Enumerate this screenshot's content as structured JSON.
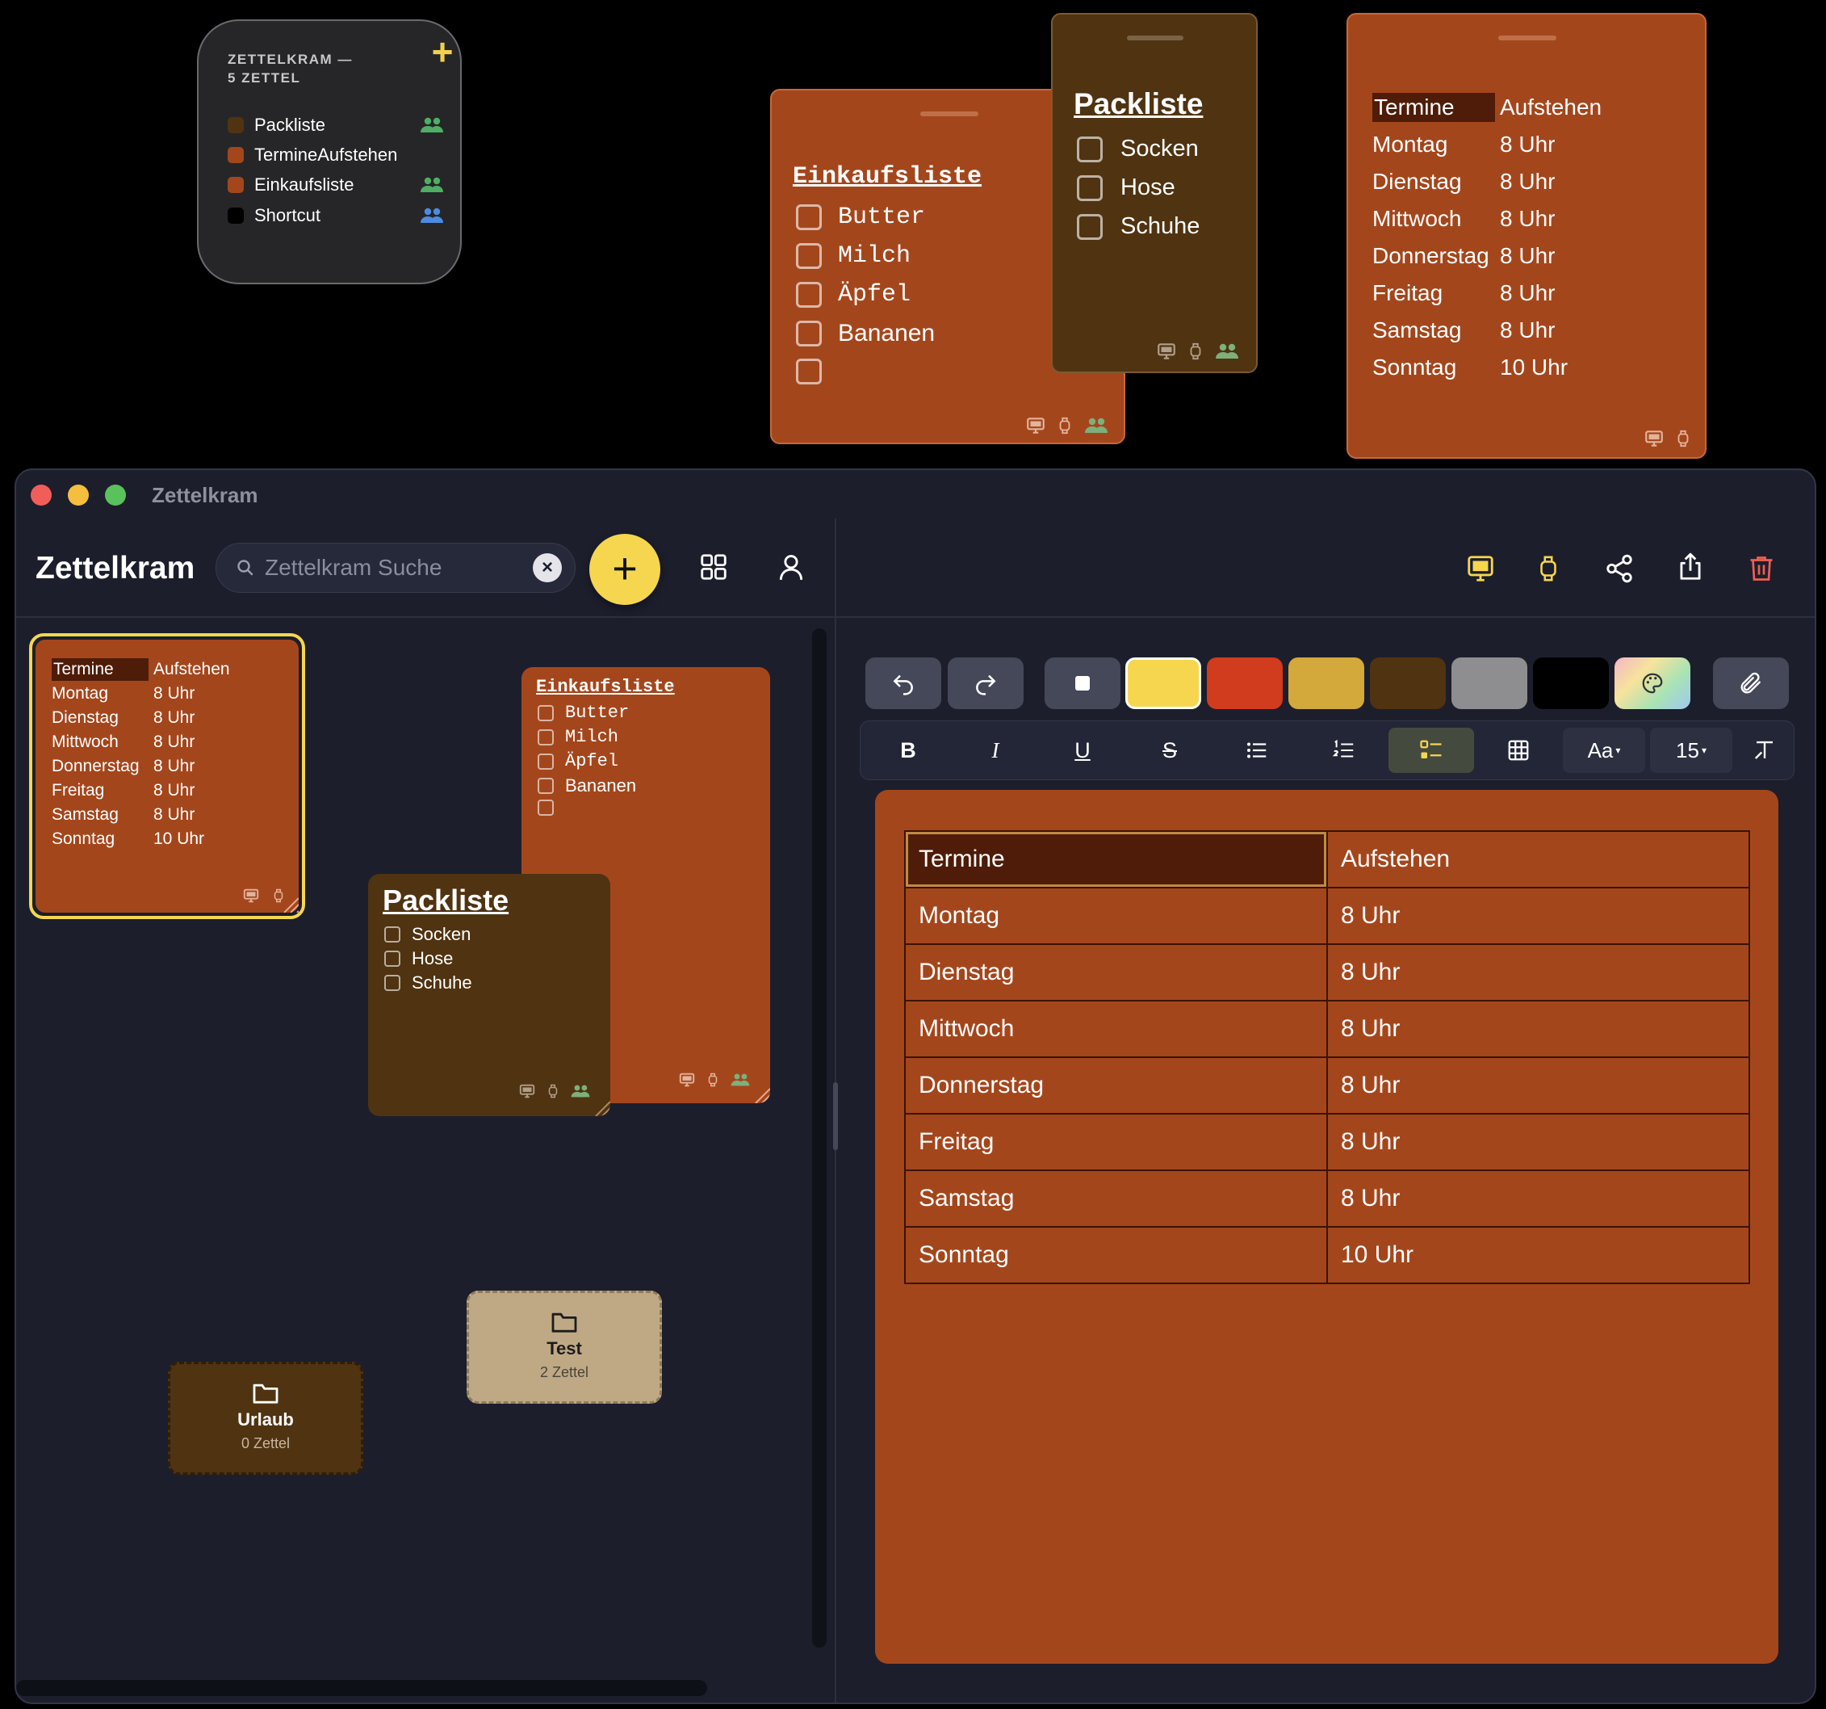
{
  "colors": {
    "note_orange": "#a4461c",
    "note_brown": "#503311",
    "accent_yellow": "#f5d64e",
    "folder_tan": "#bfa985",
    "window_bg": "#1c1e2c"
  },
  "menu_widget": {
    "title": "ZETTELKRAM — 5 ZETTEL",
    "items": [
      {
        "label": "Packliste",
        "swatch": "#503311",
        "people": "people-icon-green"
      },
      {
        "label": "TermineAufstehen",
        "swatch": "#a4461c",
        "people": ""
      },
      {
        "label": "Einkaufsliste",
        "swatch": "#a4461c",
        "people": "people-icon-green"
      },
      {
        "label": "Shortcut",
        "swatch": "#000000",
        "people": "people-icon-blue"
      }
    ]
  },
  "floating": {
    "einkauf": {
      "title": "Einkaufsliste",
      "items": [
        "Butter",
        "Milch",
        "Äpfel",
        "Bananen",
        ""
      ]
    },
    "pack": {
      "title": "Packliste",
      "items": [
        "Socken",
        "Hose",
        "Schuhe"
      ]
    },
    "termine": {
      "header": [
        "Termine",
        "Aufstehen"
      ],
      "rows": [
        [
          "Montag",
          "8 Uhr"
        ],
        [
          "Dienstag",
          "8 Uhr"
        ],
        [
          "Mittwoch",
          "8 Uhr"
        ],
        [
          "Donnerstag",
          "8 Uhr"
        ],
        [
          "Freitag",
          "8 Uhr"
        ],
        [
          "Samstag",
          "8 Uhr"
        ],
        [
          "Sonntag",
          "10 Uhr"
        ]
      ]
    }
  },
  "window": {
    "title": "Zettelkram"
  },
  "sidebar": {
    "app_title": "Zettelkram",
    "search": {
      "placeholder": "Zettelkram Suche",
      "value": ""
    },
    "board": {
      "termine": {
        "header": [
          "Termine",
          "Aufstehen"
        ],
        "rows": [
          [
            "Montag",
            "8 Uhr"
          ],
          [
            "Dienstag",
            "8 Uhr"
          ],
          [
            "Mittwoch",
            "8 Uhr"
          ],
          [
            "Donnerstag",
            "8 Uhr"
          ],
          [
            "Freitag",
            "8 Uhr"
          ],
          [
            "Samstag",
            "8 Uhr"
          ],
          [
            "Sonntag",
            "10 Uhr"
          ]
        ]
      },
      "einkauf": {
        "title": "Einkaufsliste",
        "items": [
          "Butter",
          "Milch",
          "Äpfel",
          "Bananen",
          ""
        ]
      },
      "pack": {
        "title": "Packliste",
        "items": [
          "Socken",
          "Hose",
          "Schuhe"
        ]
      },
      "folders": [
        {
          "name": "Test",
          "count": "2 Zettel"
        },
        {
          "name": "Urlaub",
          "count": "0 Zettel"
        }
      ]
    }
  },
  "editor": {
    "palette": [
      "#f5d64e",
      "#d13b1e",
      "#d2a93a",
      "#503311",
      "#8e8e90",
      "#000000"
    ],
    "format": {
      "bold": "B",
      "italic": "I",
      "underline": "U",
      "strike": "S",
      "font_label": "Aa",
      "font_size": "15"
    },
    "table": {
      "header": [
        "Termine",
        "Aufstehen"
      ],
      "rows": [
        [
          "Montag",
          "8 Uhr"
        ],
        [
          "Dienstag",
          "8 Uhr"
        ],
        [
          "Mittwoch",
          "8 Uhr"
        ],
        [
          "Donnerstag",
          "8 Uhr"
        ],
        [
          "Freitag",
          "8 Uhr"
        ],
        [
          "Samstag",
          "8 Uhr"
        ],
        [
          "Sonntag",
          "10 Uhr"
        ]
      ]
    }
  }
}
